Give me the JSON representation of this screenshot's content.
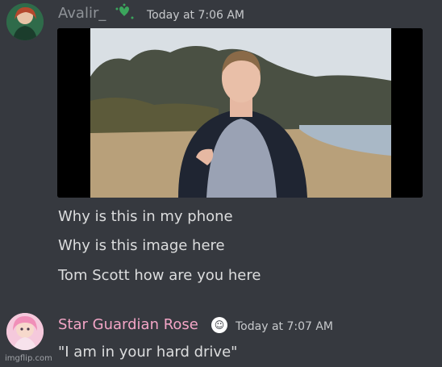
{
  "messages": [
    {
      "author": "Avalir_",
      "timestamp": "Today at 7:06 AM",
      "badge_icon": "heart-plant-icon",
      "image_desc": "video-frame",
      "lines": [
        "Why is this in my phone",
        "Why is this image here",
        "Tom Scott how are you here"
      ]
    },
    {
      "author": "Star Guardian Rose",
      "timestamp": "Today at 7:07 AM",
      "badge_icon": "emoji-badge-icon",
      "lines": [
        "\"I am in your hard drive\""
      ]
    }
  ],
  "watermark": "imgflip.com",
  "colors": {
    "background": "#36393f",
    "author1": "#8e9297",
    "author2": "#f3a5c6",
    "text": "#dcddde"
  }
}
